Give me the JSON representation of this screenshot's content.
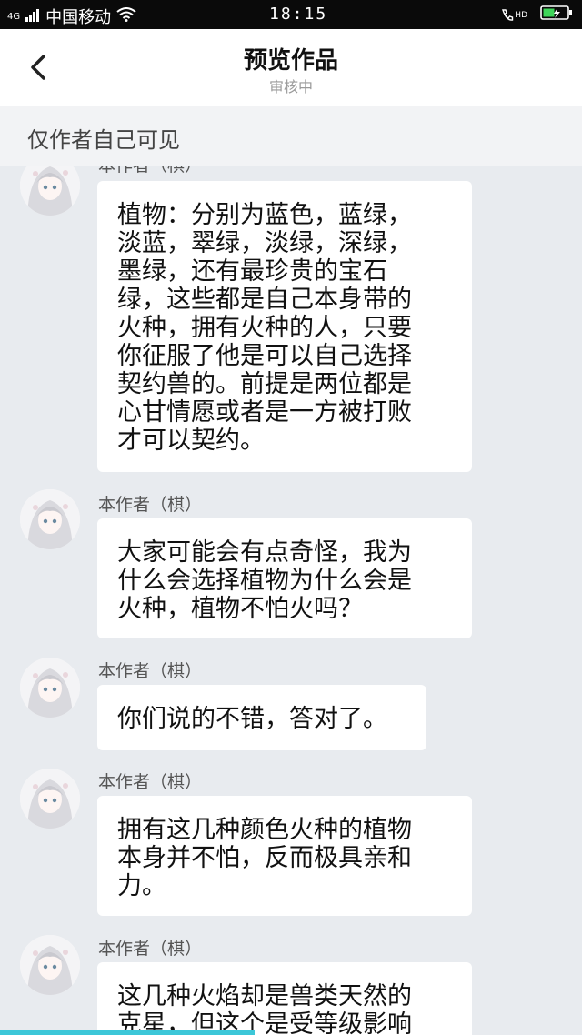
{
  "status_bar": {
    "network": "4G",
    "carrier": "中国移动",
    "time": "18:15",
    "call_badge": "HD"
  },
  "header": {
    "title": "预览作品",
    "subtitle": "审核中"
  },
  "notice": {
    "text": "仅作者自己可见"
  },
  "messages": [
    {
      "author": "本作者（棋）",
      "text": "植物：分别为蓝色，蓝绿，\n淡蓝，翠绿，淡绿，深绿，\n墨绿，还有最珍贵的宝石\n绿，这些都是自己本身带的\n火种，拥有火种的人，只要\n你征服了他是可以自己选择\n契约兽的。前提是两位都是\n心甘情愿或者是一方被打败\n才可以契约。"
    },
    {
      "author": "本作者（棋）",
      "text": "大家可能会有点奇怪，我为\n什么会选择植物为什么会是\n火种，植物不怕火吗？"
    },
    {
      "author": "本作者（棋）",
      "text": "你们说的不错，答对了。"
    },
    {
      "author": "本作者（棋）",
      "text": "拥有这几种颜色火种的植物\n本身并不怕，反而极具亲和\n力。"
    },
    {
      "author": "本作者（棋）",
      "text": "这几种火焰却是兽类天然的\n克星，但这个是受等级影响"
    }
  ],
  "colors": {
    "background": "#e8ebef",
    "bubble": "#ffffff",
    "progress": "#3cc7d8"
  }
}
